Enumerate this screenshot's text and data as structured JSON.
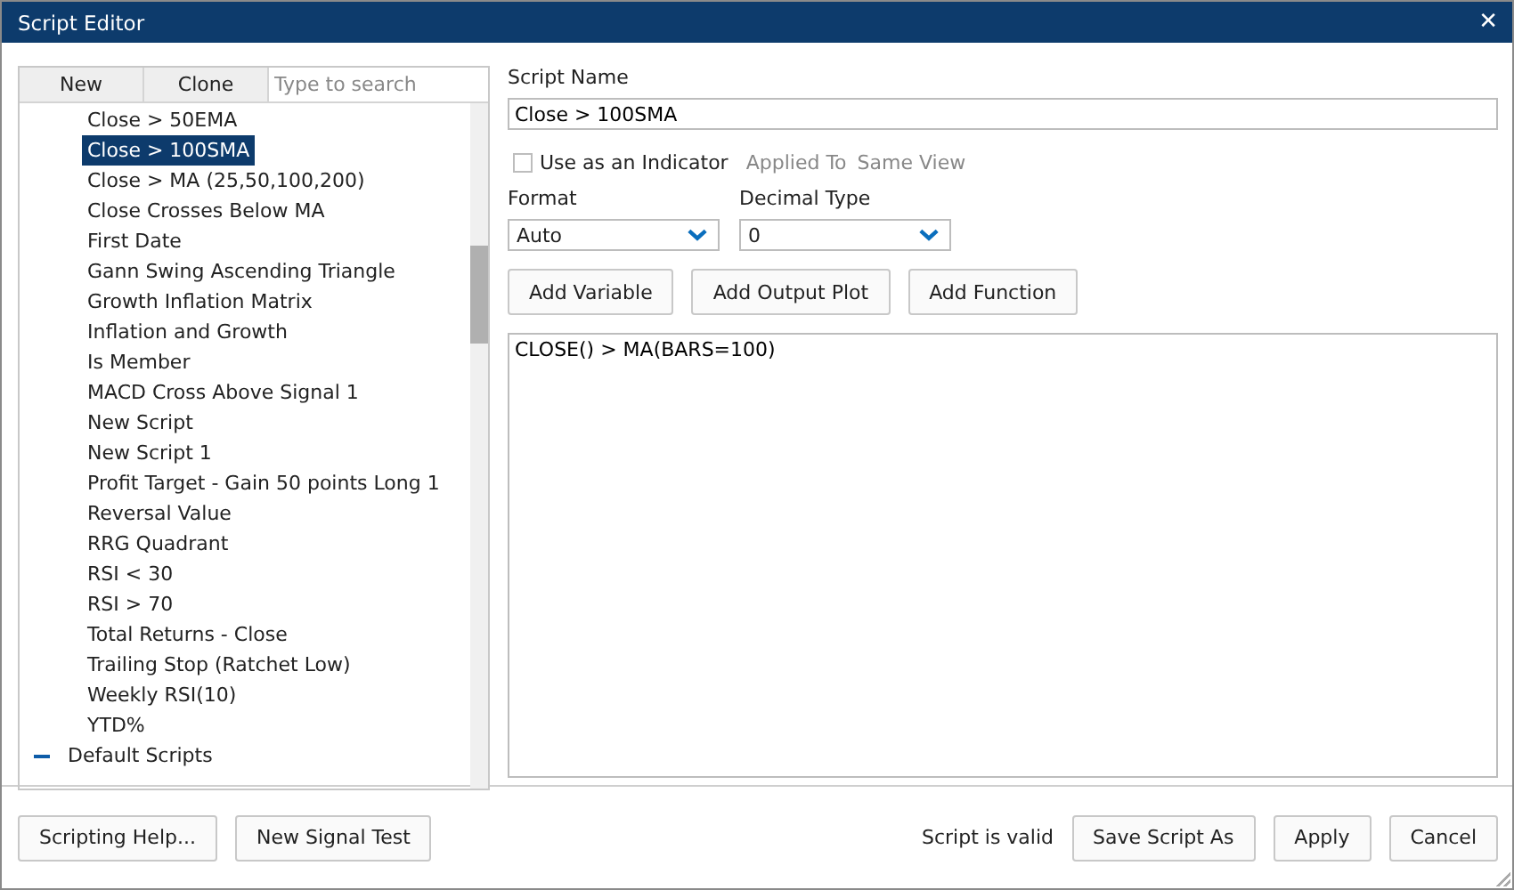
{
  "window": {
    "title": "Script Editor",
    "close": "✕"
  },
  "left_panel": {
    "buttons": [
      "New",
      "Clone"
    ],
    "search": {
      "placeholder": "Type to search"
    },
    "scripts": [
      {
        "label": "Close > 50EMA",
        "selected": false
      },
      {
        "label": "Close > 100SMA",
        "selected": true
      },
      {
        "label": "Close > MA (25,50,100,200)",
        "selected": false
      },
      {
        "label": "Close Crosses Below MA",
        "selected": false
      },
      {
        "label": "First Date",
        "selected": false
      },
      {
        "label": "Gann Swing Ascending Triangle",
        "selected": false
      },
      {
        "label": "Growth Inflation Matrix",
        "selected": false
      },
      {
        "label": "Inflation and Growth",
        "selected": false
      },
      {
        "label": "Is Member",
        "selected": false
      },
      {
        "label": "MACD Cross Above Signal 1",
        "selected": false
      },
      {
        "label": "New Script",
        "selected": false
      },
      {
        "label": "New Script 1",
        "selected": false
      },
      {
        "label": "Profit Target - Gain 50 points Long 1",
        "selected": false
      },
      {
        "label": "Reversal Value",
        "selected": false
      },
      {
        "label": "RRG Quadrant",
        "selected": false
      },
      {
        "label": "RSI < 30",
        "selected": false
      },
      {
        "label": "RSI > 70",
        "selected": false
      },
      {
        "label": "Total Returns - Close",
        "selected": false
      },
      {
        "label": "Trailing Stop (Ratchet Low)",
        "selected": false
      },
      {
        "label": "Weekly RSI(10)",
        "selected": false
      },
      {
        "label": "YTD%",
        "selected": false
      }
    ],
    "folders": [
      {
        "label": "Default Scripts",
        "expanded": true
      }
    ]
  },
  "editor": {
    "script_name_label": "Script Name",
    "script_name": "Close > 100SMA",
    "indicator": {
      "label": "Use as an Indicator",
      "checked": false
    },
    "applied_to_label": "Applied To",
    "applied_to_value": "Same View",
    "format": {
      "label": "Format",
      "value": "Auto"
    },
    "decimal_type": {
      "label": "Decimal Type",
      "value": "0"
    },
    "buttons": [
      "Add Variable",
      "Add Output Plot",
      "Add Function"
    ],
    "code": "CLOSE() > MA(BARS=100)"
  },
  "footer": {
    "left_buttons": [
      "Scripting Help...",
      "New Signal Test"
    ],
    "status": "Script is valid",
    "right_buttons": [
      "Save Script As",
      "Apply",
      "Cancel"
    ]
  }
}
